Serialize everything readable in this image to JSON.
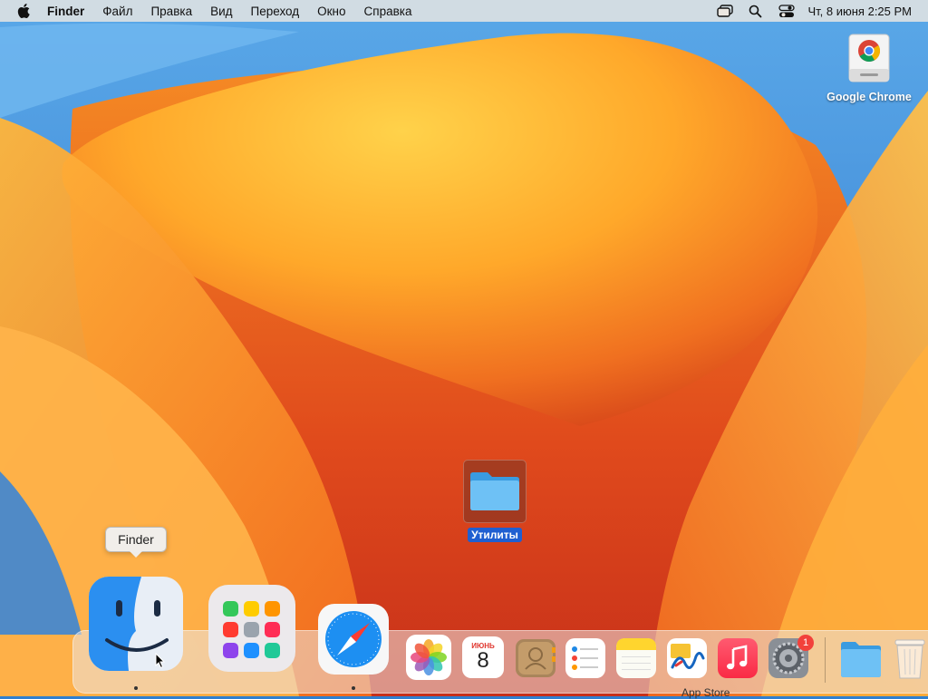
{
  "menubar": {
    "app_name": "Finder",
    "items": [
      "Файл",
      "Правка",
      "Вид",
      "Переход",
      "Окно",
      "Справка"
    ],
    "clock": "Чт, 8 июня  2:25 PM"
  },
  "desktop": {
    "chrome_drive_label": "Google Chrome",
    "folder_label": "Утилиты"
  },
  "tooltip": {
    "text": "Finder"
  },
  "dock": {
    "calendar_month": "ИЮНЬ",
    "calendar_day": "8",
    "settings_badge": "1",
    "partial_caption": "App Store"
  },
  "colors": {
    "accent_selection": "#1f5fd1",
    "badge": "#f2413b"
  }
}
